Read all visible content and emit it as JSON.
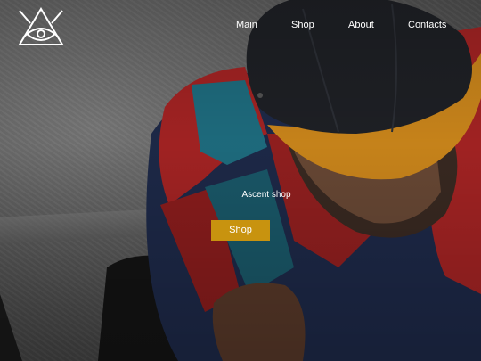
{
  "nav": {
    "items": [
      {
        "label": "Main"
      },
      {
        "label": "Shop"
      },
      {
        "label": "About"
      },
      {
        "label": "Contacts"
      }
    ]
  },
  "hero": {
    "tagline": "Ascent shop",
    "cta_label": "Shop"
  },
  "colors": {
    "accent": "#c8930f",
    "cap_brim": "#d0891c",
    "cap_crown": "#1f2126",
    "jacket_red": "#a82424",
    "jacket_teal": "#1f6f82",
    "jacket_navy": "#1e2a4a"
  },
  "icons": {
    "logo": "triangle-eye-logo-icon"
  }
}
